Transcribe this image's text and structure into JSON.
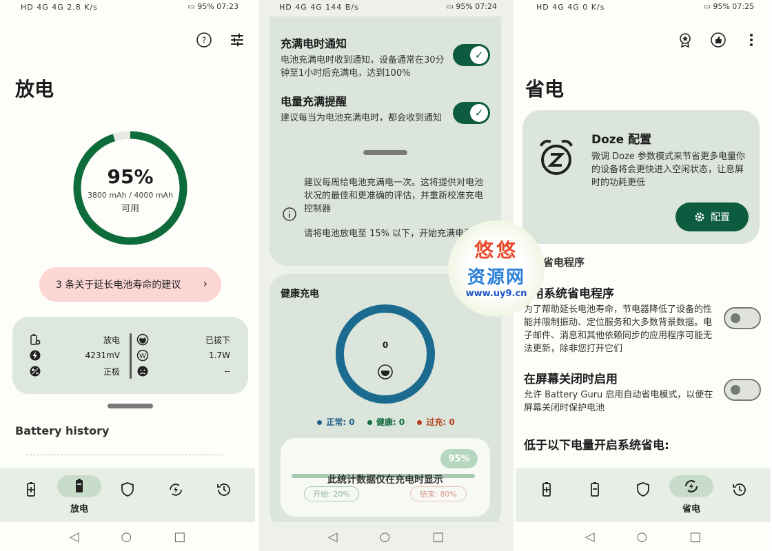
{
  "status": [
    {
      "left_text": "HD 4G 4G 2.8 K/s",
      "battery": "95%",
      "time": "07:23"
    },
    {
      "left_text": "HD 4G 4G 144 B/s",
      "battery": "95%",
      "time": "07:24"
    },
    {
      "left_text": "HD 4G 4G 0 K/s",
      "battery": "95%",
      "time": "07:25"
    }
  ],
  "screen1": {
    "title": "放电",
    "ring": {
      "percent": "95%",
      "capacity": "3800 mAh / 4000 mAh",
      "label": "可用",
      "fill": 0.95
    },
    "tip_button": "3 条关于延长电池寿命的建议",
    "stats": {
      "left": [
        {
          "icon": "battery-plus-icon",
          "value": "放电"
        },
        {
          "icon": "bolt-icon",
          "value": "4231mV"
        },
        {
          "icon": "plus-minus-icon",
          "value": "正极"
        }
      ],
      "right": [
        {
          "icon": "plug-icon",
          "value": "已拔下"
        },
        {
          "icon": "watt-icon",
          "value": "1.7W"
        },
        {
          "icon": "face-icon",
          "value": "--"
        }
      ]
    },
    "history_title": "Battery history",
    "nav_active_label": "放电"
  },
  "screen2": {
    "notify_full": {
      "title": "充满电时通知",
      "desc": "电池充满电时收到通知，设备通常在30分钟至1小时后充满电，达到100%"
    },
    "charge_reminder": {
      "title": "电量充满提醒",
      "desc": "建议每当为电池充满电时，都会收到通知"
    },
    "info_p1": "建议每周给电池充满电一次。这将提供对电池状况的最佳和更准确的评估，并重新校准充电控制器",
    "info_p2": "请将电池放电至 15% 以下，开始充满电测量",
    "health_title": "健康充电",
    "ring_value": "0",
    "legend": [
      {
        "label": "正常: 0",
        "color": "#1f5f8b"
      },
      {
        "label": "健康: 0",
        "color": "#0e6b3a"
      },
      {
        "label": "过充: 0",
        "color": "#b5401f"
      }
    ],
    "stats_note": "此统计数据仅在充电时显示",
    "stats_pct": "95%",
    "start": "开始: 20%",
    "end": "结束: 80%",
    "colors": {
      "ring": "#1a6b8f",
      "accent": "#0e5c40"
    }
  },
  "screen3": {
    "title": "省电",
    "doze": {
      "title": "Doze 配置",
      "desc": "微调 Doze 参数模式来节省更多电量你的设备将会更快进入空闲状态，让息屏时的功耗更低",
      "button": "配置"
    },
    "section": "省电程序",
    "s1": {
      "title": "用系统省电程序",
      "desc": "为了帮助延长电池寿命，节电器降低了设备的性能并限制振动、定位服务和大多数背景数据。电子邮件、消息和其他依赖同步的应用程序可能无法更新，除非您打开它们"
    },
    "s2": {
      "title": "在屏幕关闭时启用",
      "desc": "允许 Battery Guru 启用自动省电模式，以便在屏幕关闭时保护电池"
    },
    "s3": {
      "title": "低于以下电量开启系统省电:"
    },
    "nav_active_label": "省电"
  },
  "watermark": {
    "line1": "悠悠",
    "line2": "资源网",
    "line3": "www.uy9.cn"
  }
}
